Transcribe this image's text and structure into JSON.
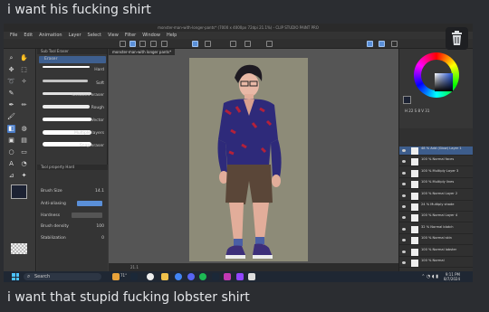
{
  "message_top": "i want his fucking shirt",
  "message_bottom": "i want that stupid fucking lobster shirt",
  "app": {
    "title": "monster-man-with-longer-pants* (7000 x 4000px 72dpi 21.1%) - CLIP STUDIO PAINT PRO",
    "menus": [
      "File",
      "Edit",
      "Animation",
      "Layer",
      "Select",
      "View",
      "Filter",
      "Window",
      "Help"
    ],
    "doc_tab": "monster-man-with longer pants*",
    "zoom": "21.1",
    "subtool_tab": "Sub Tool Eraser",
    "subtool_group": "Eraser",
    "erasers": [
      "Hard",
      "Soft",
      "Kneaded eraser",
      "Rough",
      "Vector",
      "Multiple layers",
      "Snap eraser"
    ],
    "prop_tab": "Tool property Hard",
    "props": [
      {
        "label": "Brush Size",
        "value": "14.1"
      },
      {
        "label": "Anti-aliasing",
        "value": ""
      },
      {
        "label": "Hardness",
        "value": ""
      },
      {
        "label": "Brush density",
        "value": "100"
      },
      {
        "label": "Stabilization",
        "value": "0"
      }
    ],
    "color_readout": "H 22 S 8 V 31",
    "layers": [
      {
        "name": "48 % Add (Glow) Layer 1"
      },
      {
        "name": "100 % Normal faces"
      },
      {
        "name": "100 % Multiply Layer 3"
      },
      {
        "name": "100 % Multiply lines"
      },
      {
        "name": "100 % Normal Layer 2"
      },
      {
        "name": "24 % Multiply shade"
      },
      {
        "name": "100 % Normal Layer 4"
      },
      {
        "name": "32 % Normal blotch"
      },
      {
        "name": "100 % Normal skin"
      },
      {
        "name": "100 % Normal lobster"
      },
      {
        "name": "100 % Normal"
      }
    ]
  },
  "taskbar": {
    "search_placeholder": "Search",
    "weather": "71°",
    "time": "9:11 PM",
    "date": "8/7/2024"
  }
}
